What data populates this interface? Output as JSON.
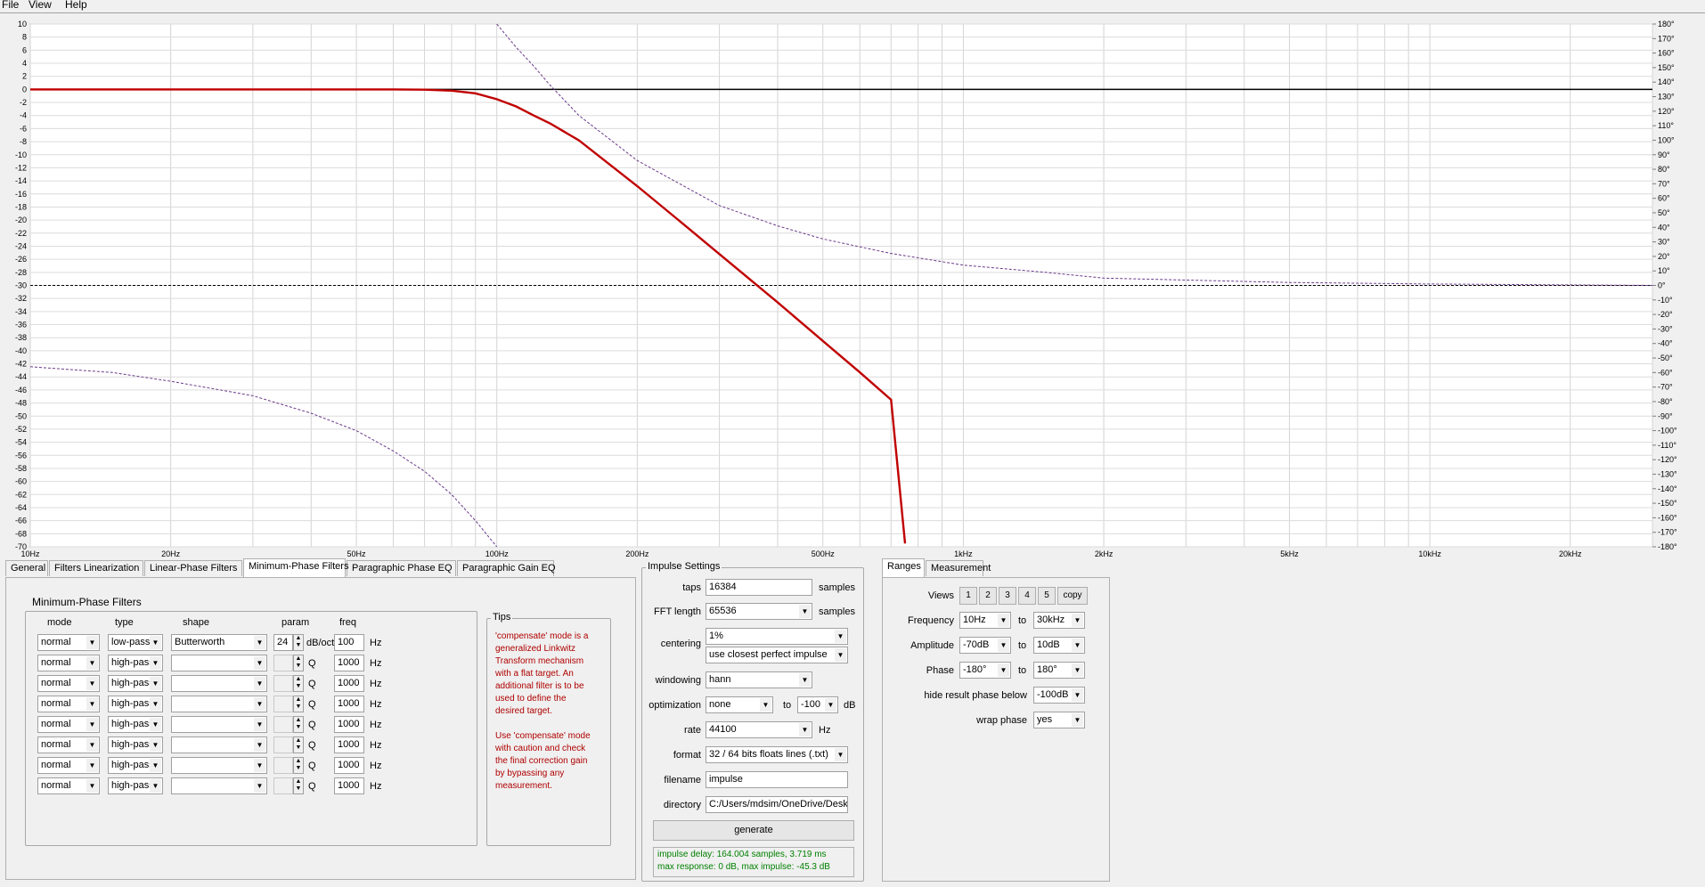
{
  "menu": [
    "File",
    "View",
    "Help"
  ],
  "chart_data": {
    "type": "line",
    "x_scale": "log",
    "xlim": [
      10,
      30000
    ],
    "ylim": [
      -70,
      10
    ],
    "y2lim": [
      -180,
      180
    ],
    "x_ticks": [
      {
        "v": 10,
        "label": "10Hz"
      },
      {
        "v": 20,
        "label": "20Hz"
      },
      {
        "v": 50,
        "label": "50Hz"
      },
      {
        "v": 100,
        "label": "100Hz"
      },
      {
        "v": 200,
        "label": "200Hz"
      },
      {
        "v": 500,
        "label": "500Hz"
      },
      {
        "v": 1000,
        "label": "1kHz"
      },
      {
        "v": 2000,
        "label": "2kHz"
      },
      {
        "v": 5000,
        "label": "5kHz"
      },
      {
        "v": 10000,
        "label": "10kHz"
      },
      {
        "v": 20000,
        "label": "20kHz"
      }
    ],
    "y_ticks_step": 2,
    "y2_ticks_step": 10,
    "grid": true,
    "reference_lines": [
      {
        "y": 0,
        "style": "solid",
        "color": "#000000"
      },
      {
        "y": -30,
        "style": "dashed",
        "color": "#000000"
      }
    ],
    "series": [
      {
        "role": "magnitude",
        "color": "#c00000",
        "style": "solid",
        "x": [
          10,
          50,
          60,
          70,
          80,
          90,
          100,
          110,
          120,
          130,
          150,
          200,
          250,
          300,
          400,
          500,
          600,
          700,
          750
        ],
        "y": [
          0,
          0,
          -0.01,
          -0.04,
          -0.2,
          -0.6,
          -1.5,
          -2.6,
          -4.0,
          -5.2,
          -7.8,
          -14.8,
          -20.5,
          -25.2,
          -32.6,
          -38.5,
          -43.3,
          -47.5,
          -69.5
        ]
      },
      {
        "role": "phase-upper",
        "color": "#6a3a8a",
        "style": "dashed",
        "axis": "y2",
        "x": [
          100,
          110,
          120,
          130,
          150,
          200,
          300,
          400,
          500,
          700,
          1000,
          1500,
          2000,
          5000,
          10000,
          30000
        ],
        "y": [
          180,
          164,
          151,
          138,
          117,
          86,
          55,
          41,
          32,
          22,
          14,
          9,
          5,
          2,
          1,
          0
        ]
      },
      {
        "role": "phase-lower",
        "color": "#6a3a8a",
        "style": "dashed",
        "axis": "y2",
        "x": [
          10,
          15,
          20,
          30,
          40,
          50,
          60,
          70,
          80,
          90,
          100
        ],
        "y": [
          -56,
          -60,
          -66,
          -76,
          -88,
          -100,
          -114,
          -128,
          -144,
          -162,
          -180
        ]
      }
    ]
  },
  "tabs_left": [
    "General",
    "Filters Linearization",
    "Linear-Phase Filters",
    "Minimum-Phase Filters",
    "Paragraphic Phase EQ",
    "Paragraphic Gain EQ"
  ],
  "tabs_left_active": 3,
  "mpf": {
    "section_title": "Minimum-Phase Filters",
    "headers": {
      "mode": "mode",
      "type": "type",
      "shape": "shape",
      "param": "param",
      "freq": "freq"
    },
    "rows": [
      {
        "mode": "normal",
        "type": "low-pass",
        "shape": "Butterworth",
        "param": "24",
        "unit": "dB/oct",
        "freq": "100",
        "hz": "Hz"
      },
      {
        "mode": "normal",
        "type": "high-pass",
        "shape": "",
        "param": "",
        "unit": "Q",
        "freq": "1000",
        "hz": "Hz"
      },
      {
        "mode": "normal",
        "type": "high-pass",
        "shape": "",
        "param": "",
        "unit": "Q",
        "freq": "1000",
        "hz": "Hz"
      },
      {
        "mode": "normal",
        "type": "high-pass",
        "shape": "",
        "param": "",
        "unit": "Q",
        "freq": "1000",
        "hz": "Hz"
      },
      {
        "mode": "normal",
        "type": "high-pass",
        "shape": "",
        "param": "",
        "unit": "Q",
        "freq": "1000",
        "hz": "Hz"
      },
      {
        "mode": "normal",
        "type": "high-pass",
        "shape": "",
        "param": "",
        "unit": "Q",
        "freq": "1000",
        "hz": "Hz"
      },
      {
        "mode": "normal",
        "type": "high-pass",
        "shape": "",
        "param": "",
        "unit": "Q",
        "freq": "1000",
        "hz": "Hz"
      },
      {
        "mode": "normal",
        "type": "high-pass",
        "shape": "",
        "param": "",
        "unit": "Q",
        "freq": "1000",
        "hz": "Hz"
      }
    ],
    "tips_title": "Tips",
    "tips_lines": [
      "'compensate' mode is a",
      "generalized Linkwitz",
      "Transform mechanism",
      "with a flat target. An",
      "additional filter is to be",
      "used to define the",
      "desired target.",
      "",
      "Use 'compensate' mode",
      "with caution and check",
      "the final correction gain",
      "by bypassing any",
      "measurement."
    ],
    "tips_color": "#b00000"
  },
  "impulse": {
    "title": "Impulse Settings",
    "taps_label": "taps",
    "taps": "16384",
    "taps_unit": "samples",
    "fft_label": "FFT length",
    "fft": "65536",
    "fft_unit": "samples",
    "centering_label": "centering",
    "centering": "1%",
    "centering2": "use closest perfect impulse",
    "windowing_label": "windowing",
    "windowing": "hann",
    "optimization_label": "optimization",
    "optimization": "none",
    "opt_to": "to",
    "opt_val": "-100",
    "opt_unit": "dB",
    "rate_label": "rate",
    "rate": "44100",
    "rate_unit": "Hz",
    "format_label": "format",
    "format": "32 / 64 bits floats lines (.txt)",
    "filename_label": "filename",
    "filename": "impulse",
    "directory_label": "directory",
    "directory": "C:/Users/mdsim/OneDrive/Deskto",
    "generate": "generate",
    "status1": "impulse delay: 164.004 samples, 3.719 ms",
    "status2": "max response: 0 dB, max impulse: -45.3 dB",
    "status_color": "#008000"
  },
  "tabs_right": [
    "Ranges",
    "Measurement"
  ],
  "tabs_right_active": 0,
  "ranges": {
    "views_label": "Views",
    "views": [
      "1",
      "2",
      "3",
      "4",
      "5"
    ],
    "copy": "copy",
    "frequency_label": "Frequency",
    "freq_from": "10Hz",
    "freq_to": "30kHz",
    "amplitude_label": "Amplitude",
    "amp_from": "-70dB",
    "amp_to": "10dB",
    "phase_label": "Phase",
    "phase_from": "-180°",
    "phase_to": "180°",
    "to": "to",
    "hide_label": "hide result phase below",
    "hide_val": "-100dB",
    "wrap_label": "wrap phase",
    "wrap_val": "yes"
  }
}
